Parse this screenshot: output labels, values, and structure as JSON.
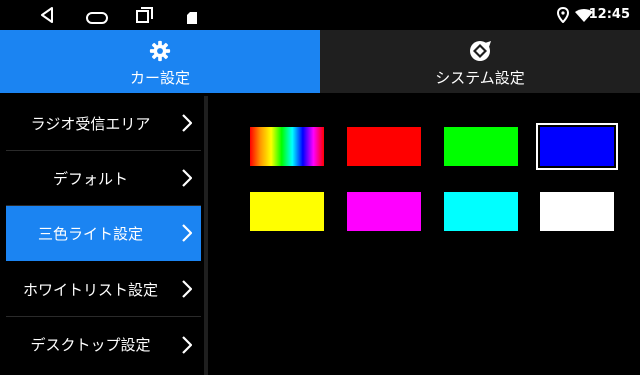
{
  "status": {
    "time": "12:45",
    "icons": [
      "back-icon",
      "home-icon",
      "recents-icon",
      "sd-card-icon",
      "location-icon",
      "wifi-icon"
    ]
  },
  "tabs": [
    {
      "label": "カー設定",
      "icon": "gear-icon",
      "active": true
    },
    {
      "label": "システム設定",
      "icon": "system-logo-icon",
      "active": false
    }
  ],
  "sidebar": {
    "items": [
      {
        "label": "ラジオ受信エリア",
        "active": false
      },
      {
        "label": "デフォルト",
        "active": false
      },
      {
        "label": "三色ライト設定",
        "active": true
      },
      {
        "label": "ホワイトリスト設定",
        "active": false
      },
      {
        "label": "デスクトップ設定",
        "active": false
      }
    ]
  },
  "colors": {
    "accent": "#1b84f2",
    "swatches": [
      "rainbow",
      "#ff0000",
      "#00ff00",
      "#0000ff",
      "#ffff00",
      "#ff00ff",
      "#00ffff",
      "#ffffff"
    ],
    "selected": "#0000ff"
  }
}
